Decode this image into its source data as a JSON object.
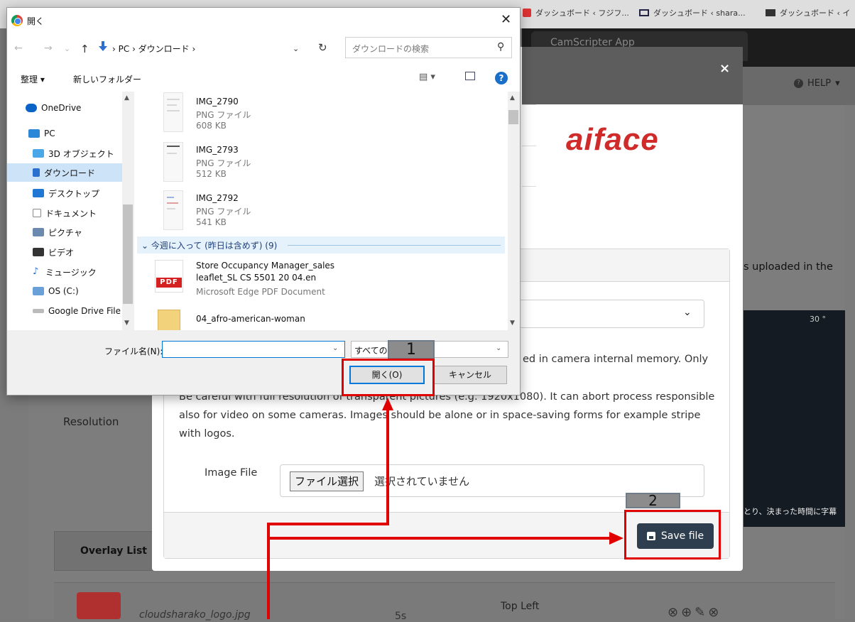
{
  "browser": {
    "tabs": [
      "ダッシュボード ‹ フジフ...",
      "ダッシュボード ‹ shara...",
      "ダッシュボード ‹ イ"
    ]
  },
  "background": {
    "app_title": "CamScripter App",
    "help_label": "HELP",
    "help_caret": "▾",
    "uploaded_text": "s uploaded in the",
    "camera_temp": "30 °",
    "camera_caption": "とり、決まった時間に字幕",
    "resolution_label": "Resolution",
    "overlay_list_label": "Overlay List",
    "overlay_row": {
      "file_name": "cloudsharako_logo.jpg",
      "duration": "5s",
      "position": "Top Left",
      "actions": "⊗⊕✎⊗"
    }
  },
  "modal": {
    "close_label": "×",
    "brand": "aiface",
    "select_chevron": "⌄",
    "storage_note_fragment": "ed in camera internal memory. Only",
    "warning": "Be careful with full resolution of transparent pictures (e.g. 1920x1080). It can abort process responsible also for video on some cameras. Images should be alone or in space-saving forms for example stripe with logos.",
    "image_file_label": "Image File",
    "file_button": "ファイル選択",
    "file_status": "選択されていません",
    "save_button": "Save file"
  },
  "dialog": {
    "title": "開く",
    "close": "✕",
    "nav": {
      "back": "←",
      "forward": "→",
      "history": "⌄",
      "up": "↑"
    },
    "path": "PC  ›  ダウンロード  ›",
    "path_prefix": "›",
    "address_dropdown": "⌄",
    "refresh": "↻",
    "search_placeholder": "ダウンロードの検索",
    "search_icon": "⚲",
    "organize": "整理 ▾",
    "new_folder": "新しいフォルダー",
    "view_menu": "▤ ▾",
    "help": "?",
    "nav_items": [
      {
        "label": "OneDrive",
        "icon": "cloud-icon",
        "color": "#0a64c8"
      },
      {
        "label": "PC",
        "icon": "pc-icon",
        "color": "#2b88d8"
      },
      {
        "label": "3D オブジェクト",
        "icon": "cube-icon",
        "color": "#4aa8e8"
      },
      {
        "label": "ダウンロード",
        "icon": "download-arrow-icon",
        "color": "#2b6fd1"
      },
      {
        "label": "デスクトップ",
        "icon": "desktop-icon",
        "color": "#1e78d4"
      },
      {
        "label": "ドキュメント",
        "icon": "document-icon",
        "color": "#8a8a8a"
      },
      {
        "label": "ピクチャ",
        "icon": "pictures-icon",
        "color": "#6a8ab0"
      },
      {
        "label": "ビデオ",
        "icon": "video-icon",
        "color": "#333333"
      },
      {
        "label": "ミュージック",
        "icon": "music-icon",
        "color": "#2b6fd1"
      },
      {
        "label": "OS (C:)",
        "icon": "drive-icon",
        "color": "#6aa0d8"
      },
      {
        "label": "Google Drive File",
        "icon": "drive-disk-icon",
        "color": "#888888"
      }
    ],
    "files": [
      {
        "name": "IMG_2790",
        "type": "PNG ファイル",
        "size": "608 KB"
      },
      {
        "name": "IMG_2793",
        "type": "PNG ファイル",
        "size": "512 KB"
      },
      {
        "name": "IMG_2792",
        "type": "PNG ファイル",
        "size": "541 KB"
      }
    ],
    "group_header": "⌄ 今週に入って (昨日は含めず) (9)",
    "pdf_file": {
      "line1": "Store Occupancy Manager_sales",
      "line2": "leaflet_SL CS 5501 20 04.en",
      "type": "Microsoft Edge PDF Document",
      "icon_label": "PDF"
    },
    "zip_file": {
      "name": "04_afro-american-woman"
    },
    "filename_label": "ファイル名(N):",
    "filename_value": "",
    "filter": "すべての",
    "dropdown_glyph": "⌄",
    "open_button": "開く(O)",
    "cancel_button": "キャンセル"
  },
  "annotations": {
    "step1": "1",
    "step2": "2",
    "color": "#e00000"
  }
}
